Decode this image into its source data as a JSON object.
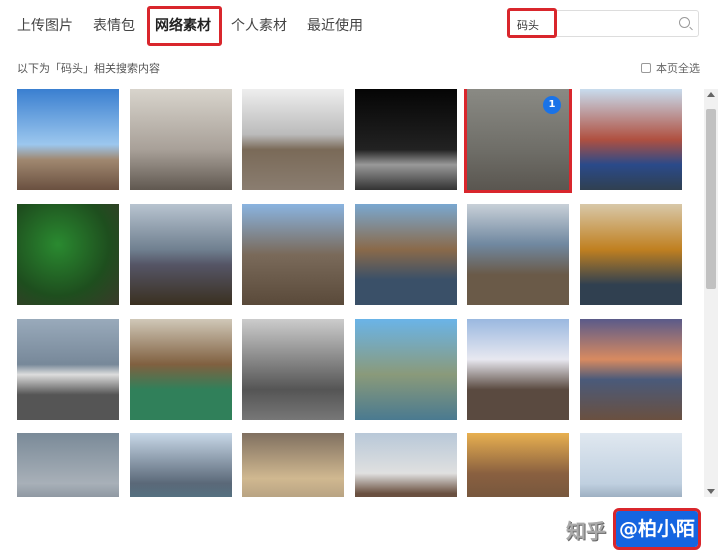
{
  "tabs": [
    {
      "label": "上传图片"
    },
    {
      "label": "表情包"
    },
    {
      "label": "网络素材",
      "active": true
    },
    {
      "label": "个人素材"
    },
    {
      "label": "最近使用"
    }
  ],
  "search": {
    "value": "码头",
    "icon": "search-icon"
  },
  "hint": "以下为「码头」相关搜索内容",
  "select_all": "本页全选",
  "selected_badge": "1",
  "watermark": {
    "site": "知乎",
    "author": "@柏小陌"
  },
  "colors": {
    "accent": "#1565e0",
    "highlight": "#d9262c"
  }
}
